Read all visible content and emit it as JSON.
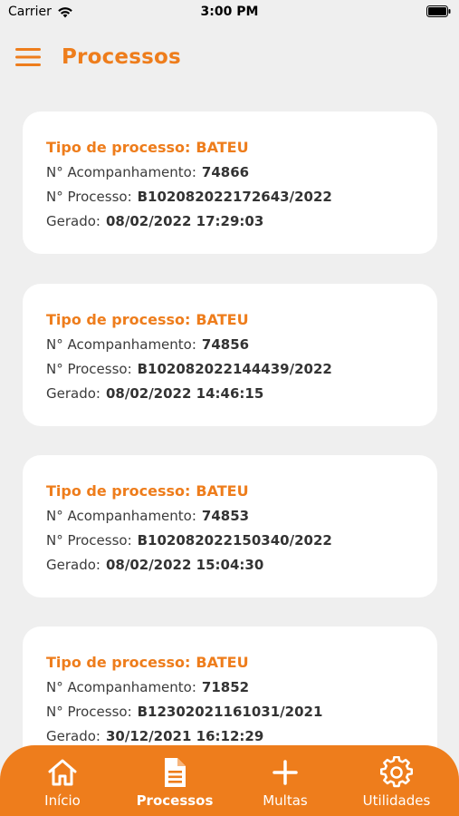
{
  "status_bar": {
    "carrier": "Carrier",
    "time": "3:00 PM"
  },
  "header": {
    "title": "Processos"
  },
  "cards": [
    {
      "tipo_label": "Tipo de processo:",
      "tipo_value": "BATEU",
      "acomp_label": "N° Acompanhamento:",
      "acomp_value": "74866",
      "processo_label": "N° Processo:",
      "processo_value": "B102082022172643/2022",
      "gerado_label": "Gerado:",
      "gerado_value": "08/02/2022 17:29:03"
    },
    {
      "tipo_label": "Tipo de processo:",
      "tipo_value": "BATEU",
      "acomp_label": "N° Acompanhamento:",
      "acomp_value": "74856",
      "processo_label": "N° Processo:",
      "processo_value": "B102082022144439/2022",
      "gerado_label": "Gerado:",
      "gerado_value": "08/02/2022 14:46:15"
    },
    {
      "tipo_label": "Tipo de processo:",
      "tipo_value": "BATEU",
      "acomp_label": "N° Acompanhamento:",
      "acomp_value": "74853",
      "processo_label": "N° Processo:",
      "processo_value": "B102082022150340/2022",
      "gerado_label": "Gerado:",
      "gerado_value": "08/02/2022 15:04:30"
    },
    {
      "tipo_label": "Tipo de processo:",
      "tipo_value": "BATEU",
      "acomp_label": "N° Acompanhamento:",
      "acomp_value": "71852",
      "processo_label": "N° Processo:",
      "processo_value": "B12302021161031/2021",
      "gerado_label": "Gerado:",
      "gerado_value": "30/12/2021 16:12:29"
    }
  ],
  "tabs": [
    {
      "label": "Início",
      "icon": "home-icon",
      "active": false
    },
    {
      "label": "Processos",
      "icon": "document-icon",
      "active": true
    },
    {
      "label": "Multas",
      "icon": "plus-icon",
      "active": false
    },
    {
      "label": "Utilidades",
      "icon": "gear-icon",
      "active": false
    }
  ],
  "colors": {
    "accent": "#ee7d1c",
    "background": "#efefef",
    "card": "#ffffff",
    "text": "#3b3b3b"
  }
}
